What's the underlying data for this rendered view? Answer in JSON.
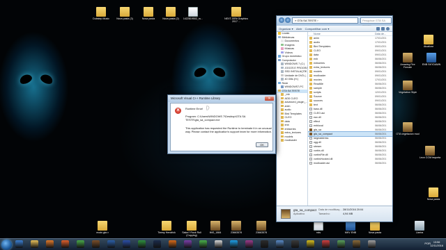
{
  "desktop_icons": [
    {
      "label": "Dubstep Music",
      "type": "folder"
    },
    {
      "label": "Nova pasta (3)",
      "type": "folder"
    },
    {
      "label": "Nova pasta",
      "type": "folder"
    },
    {
      "label": "Nova pasta (2)",
      "type": "folder"
    },
    {
      "label": "1422819502_ru...",
      "type": "file"
    },
    {
      "label": "NEXT-GEN Graphics 2017 ...",
      "type": "folder"
    },
    {
      "label": "Atualizar",
      "type": "folder"
    },
    {
      "label": "Amazing Fire Female",
      "type": "img"
    },
    {
      "label": "ENB SKYDAWN",
      "type": "app"
    },
    {
      "label": "Vegetation Style",
      "type": "img"
    },
    {
      "label": "GTA vegetacion mod",
      "type": "img"
    },
    {
      "label": "Leon COM tequeta",
      "type": "img"
    },
    {
      "label": "Nova pasta",
      "type": "folder"
    },
    {
      "label": "mods gta v",
      "type": "folder"
    },
    {
      "label": "Timmy Hendrick",
      "type": "folder"
    },
    {
      "label": "Salon? Rock Roll (Copying)",
      "type": "folder"
    },
    {
      "label": "IMG_1884",
      "type": "img"
    },
    {
      "label": "23663578",
      "type": "img"
    },
    {
      "label": "23663578",
      "type": "img"
    },
    {
      "label": "mkv",
      "type": "file"
    },
    {
      "label": "MKV ENB",
      "type": "app"
    },
    {
      "label": "Nova pasta",
      "type": "folder"
    },
    {
      "label": "Lixeira",
      "type": "trash"
    }
  ],
  "explorer": {
    "address": "« GTA SA TESTE ›",
    "search_placeholder": "Pesquisar GTA SA TESTE",
    "toolbar": {
      "organize": "Organizar ▾",
      "open": "Abrir",
      "share": "Compartilhar com ▾"
    },
    "nav_items": [
      {
        "label": "Locais",
        "icon": "star"
      },
      {
        "label": "Bibliotecas",
        "icon": "library"
      },
      {
        "label": "Documentos",
        "icon": "document"
      },
      {
        "label": "Imagens",
        "icon": "image"
      },
      {
        "label": "Músicas",
        "icon": "music"
      },
      {
        "label": "Vídeos",
        "icon": "video"
      },
      {
        "label": "Grupo doméstico",
        "icon": "group"
      },
      {
        "label": "Computador",
        "icon": "computer"
      },
      {
        "label": "WINDOWS 7 (C:)",
        "icon": "drive"
      },
      {
        "label": "JOGOS E PROGRA...",
        "icon": "drive"
      },
      {
        "label": "SSD INSTALAÇÕE...",
        "icon": "drive"
      },
      {
        "label": "Unidade de DVD (...",
        "icon": "dvd"
      },
      {
        "label": "40 GBs (H:)",
        "icon": "drive"
      },
      {
        "label": "Rede",
        "icon": "network"
      },
      {
        "label": "WINDOWS7-PC",
        "icon": "computer"
      },
      {
        "label": "GTA SA TESTE",
        "icon": "folder"
      },
      {
        "label": "_mb",
        "icon": "folder"
      },
      {
        "label": "ADD CLEO",
        "icon": "folder"
      },
      {
        "label": "advanced_plugin_...",
        "icon": "folder"
      },
      {
        "label": "anim",
        "icon": "folder"
      },
      {
        "label": "audio",
        "icon": "folder"
      },
      {
        "label": "Bird Templates",
        "icon": "folder"
      },
      {
        "label": "CLEO",
        "icon": "folder"
      },
      {
        "label": "data",
        "icon": "folder"
      },
      {
        "label": "enb",
        "icon": "folder"
      },
      {
        "label": "enbseries",
        "icon": "folder"
      },
      {
        "label": "extra_textures",
        "icon": "folder"
      },
      {
        "label": "models",
        "icon": "folder"
      },
      {
        "label": "modloader",
        "icon": "folder"
      }
    ],
    "list_headers": {
      "name": "Nome",
      "date": "Data de..."
    },
    "files": [
      {
        "name": "anim",
        "date": "17/01/201",
        "type": "folder"
      },
      {
        "name": "audio",
        "date": "17/01/201",
        "type": "folder"
      },
      {
        "name": "Bird Templates",
        "date": "09/01/201",
        "type": "folder"
      },
      {
        "name": "CLEO",
        "date": "09/01/201",
        "type": "folder"
      },
      {
        "name": "data",
        "date": "09/01/201",
        "type": "folder"
      },
      {
        "name": "enb",
        "date": "06/06/201",
        "type": "folder"
      },
      {
        "name": "enbseries",
        "date": "06/06/201",
        "type": "folder"
      },
      {
        "name": "extra_textures",
        "date": "06/06/201",
        "type": "folder"
      },
      {
        "name": "models",
        "date": "09/01/201",
        "type": "folder"
      },
      {
        "name": "modloader",
        "date": "09/01/201",
        "type": "folder"
      },
      {
        "name": "movies",
        "date": "17/01/201",
        "type": "folder"
      },
      {
        "name": "ReadMe",
        "date": "06/06/201",
        "type": "folder"
      },
      {
        "name": "sample",
        "date": "06/06/201",
        "type": "folder"
      },
      {
        "name": "scripts",
        "date": "12/01/201",
        "type": "folder"
      },
      {
        "name": "Source",
        "date": "09/01/201",
        "type": "folder"
      },
      {
        "name": "sources",
        "date": "09/01/201",
        "type": "folder"
      },
      {
        "name": "text",
        "date": "06/06/201",
        "type": "folder"
      },
      {
        "name": "bass.dll",
        "date": "06/06/201",
        "type": "file"
      },
      {
        "name": "CLEO.asi",
        "date": "06/06/201",
        "type": "file"
      },
      {
        "name": "eax.dll",
        "date": "06/06/201",
        "type": "file"
      },
      {
        "name": "effect",
        "date": "06/06/201",
        "type": "file"
      },
      {
        "name": "enblocal",
        "date": "06/06/201",
        "type": "file"
      },
      {
        "name": "gta_sa",
        "date": "06/06/201",
        "type": "app"
      },
      {
        "name": "gta_sa_compact",
        "date": "06/06/201",
        "type": "app"
      },
      {
        "name": "largeaddress",
        "date": "06/06/201",
        "type": "file"
      },
      {
        "name": "ogg.dll",
        "date": "06/06/201",
        "type": "file"
      },
      {
        "name": "stream",
        "date": "06/06/201",
        "type": "file"
      },
      {
        "name": "vorbis.dll",
        "date": "06/06/201",
        "type": "file"
      },
      {
        "name": "vorbisFile.dll",
        "date": "06/06/201",
        "type": "file"
      },
      {
        "name": "vorbisHooked.dll",
        "date": "06/06/201",
        "type": "file"
      },
      {
        "name": "modloader.asi",
        "date": "06/06/201",
        "type": "file"
      }
    ],
    "details": {
      "name": "gta_sa_compact",
      "type": "Aplicativo",
      "modified_label": "Data de modificaç...",
      "modified_value": "28/11/2016 20:04",
      "size_label": "Tamanho:",
      "size_value": "4,94 MB"
    }
  },
  "dialog": {
    "title": "Microsoft Visual C++ Runtime Library",
    "close_glyph": "✕",
    "error_glyph": "✕",
    "heading": "Runtime Error!",
    "program": "Program: C:\\Users\\WINDOWS 7\\Desktop\\GTA SA TESTE\\gta_sa_compact.exe",
    "message": "This application has requested the Runtime to terminate it in an unusual way. Please contact the application's support team for more information.",
    "ok_label": "OK"
  },
  "taskbar": {
    "apps": [
      "ie",
      "explorer",
      "media",
      "firefox",
      "chrome",
      "game",
      "photoshop",
      "word",
      "excel",
      "steam",
      "media-player",
      "vs",
      "utorrent",
      "mail",
      "skype",
      "winrar",
      "cmd",
      "network",
      "obs",
      "fraps",
      "chat",
      "tool",
      "gta",
      "cpu"
    ],
    "lang": "POR",
    "time": "13:56",
    "date": "12/11/2016"
  },
  "colors": {
    "error": "#c42b1c",
    "window_frame": "#bcd3ea",
    "selection": "#cce4f7"
  }
}
